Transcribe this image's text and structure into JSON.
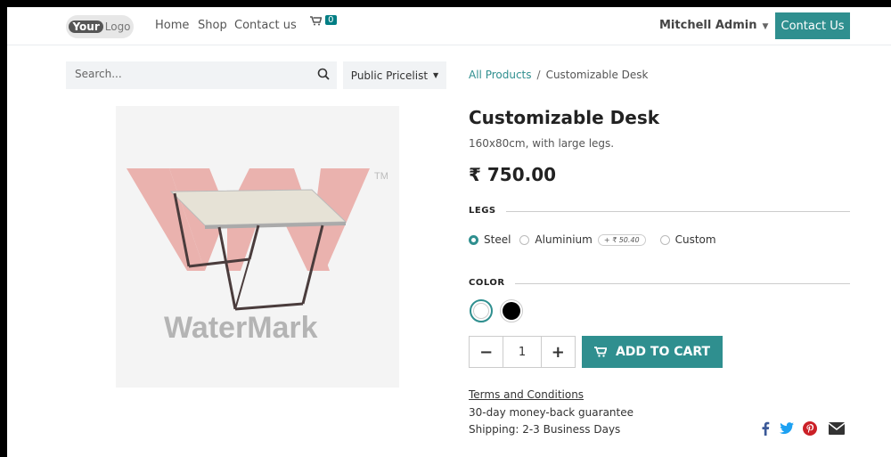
{
  "navbar": {
    "logo_main": "Your",
    "logo_secondary": "Logo",
    "links": [
      "Home",
      "Shop",
      "Contact us"
    ],
    "cart_count": "0",
    "user_name": "Mitchell Admin",
    "contact_button": "Contact Us"
  },
  "search": {
    "placeholder": "Search..."
  },
  "pricelist": {
    "label": "Public Pricelist"
  },
  "breadcrumb": {
    "parent": "All Products",
    "separator": "/",
    "current": "Customizable Desk"
  },
  "product": {
    "name": "Customizable Desk",
    "description": "160x80cm, with large legs.",
    "price": "₹ 750.00",
    "image": {
      "watermark": "WaterMark",
      "trademark": "TM"
    }
  },
  "attributes": {
    "legs": {
      "label": "LEGS",
      "options": [
        {
          "label": "Steel",
          "selected": true
        },
        {
          "label": "Aluminium",
          "extra": "+ ₹ 50.40",
          "selected": false
        },
        {
          "label": "Custom",
          "selected": false
        }
      ]
    },
    "color": {
      "label": "COLOR",
      "swatches": [
        {
          "name": "White",
          "color": "#ffffff",
          "selected": true
        },
        {
          "name": "Black",
          "color": "#000000",
          "selected": false
        }
      ]
    }
  },
  "quantity": {
    "minus": "−",
    "value": "1",
    "plus": "+"
  },
  "add_to_cart": {
    "label": "ADD TO CART"
  },
  "footer_info": {
    "terms": "Terms and Conditions",
    "guarantee": "30-day money-back guarantee",
    "shipping": "Shipping: 2-3 Business Days"
  },
  "social": [
    "facebook-icon",
    "twitter-icon",
    "pinterest-icon",
    "email-icon"
  ],
  "colors": {
    "accent": "#2f8f8f",
    "brand": "#875a7b"
  }
}
